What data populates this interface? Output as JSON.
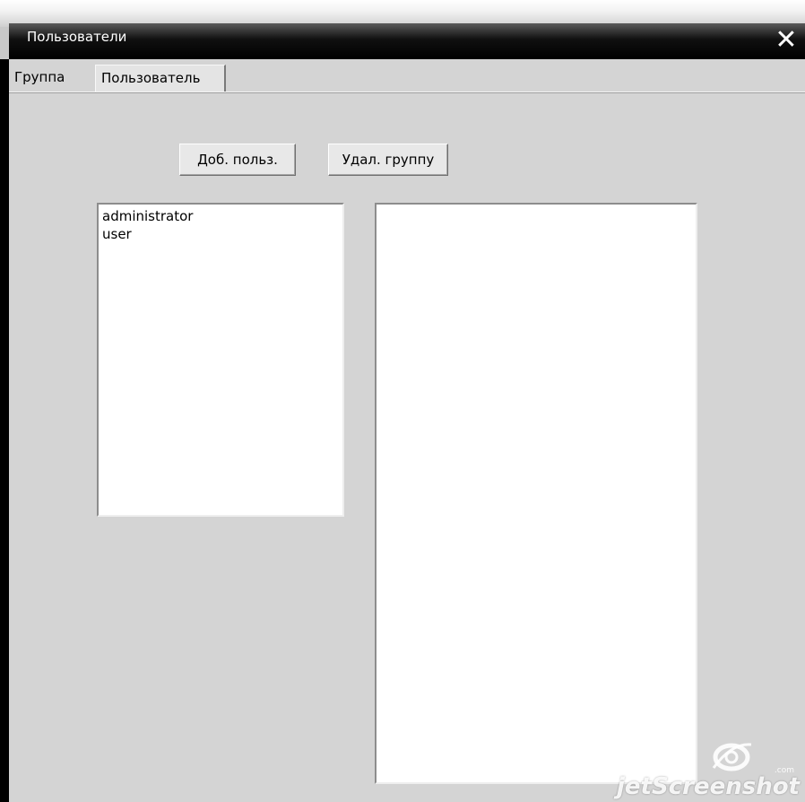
{
  "window": {
    "title": "Пользователи",
    "close_icon": "close-icon"
  },
  "tabs": [
    {
      "label": "Группа",
      "active": true
    },
    {
      "label": "Пользователь",
      "active": false
    }
  ],
  "toolbar": {
    "add_user_label": "Доб. польз.",
    "delete_group_label": "Удал. группу"
  },
  "groups_list": {
    "items": [
      {
        "label": "administrator"
      },
      {
        "label": "user"
      }
    ]
  },
  "users_list": {
    "items": []
  },
  "watermark": {
    "text": "jetScreenshot",
    "suffix": ".com"
  }
}
